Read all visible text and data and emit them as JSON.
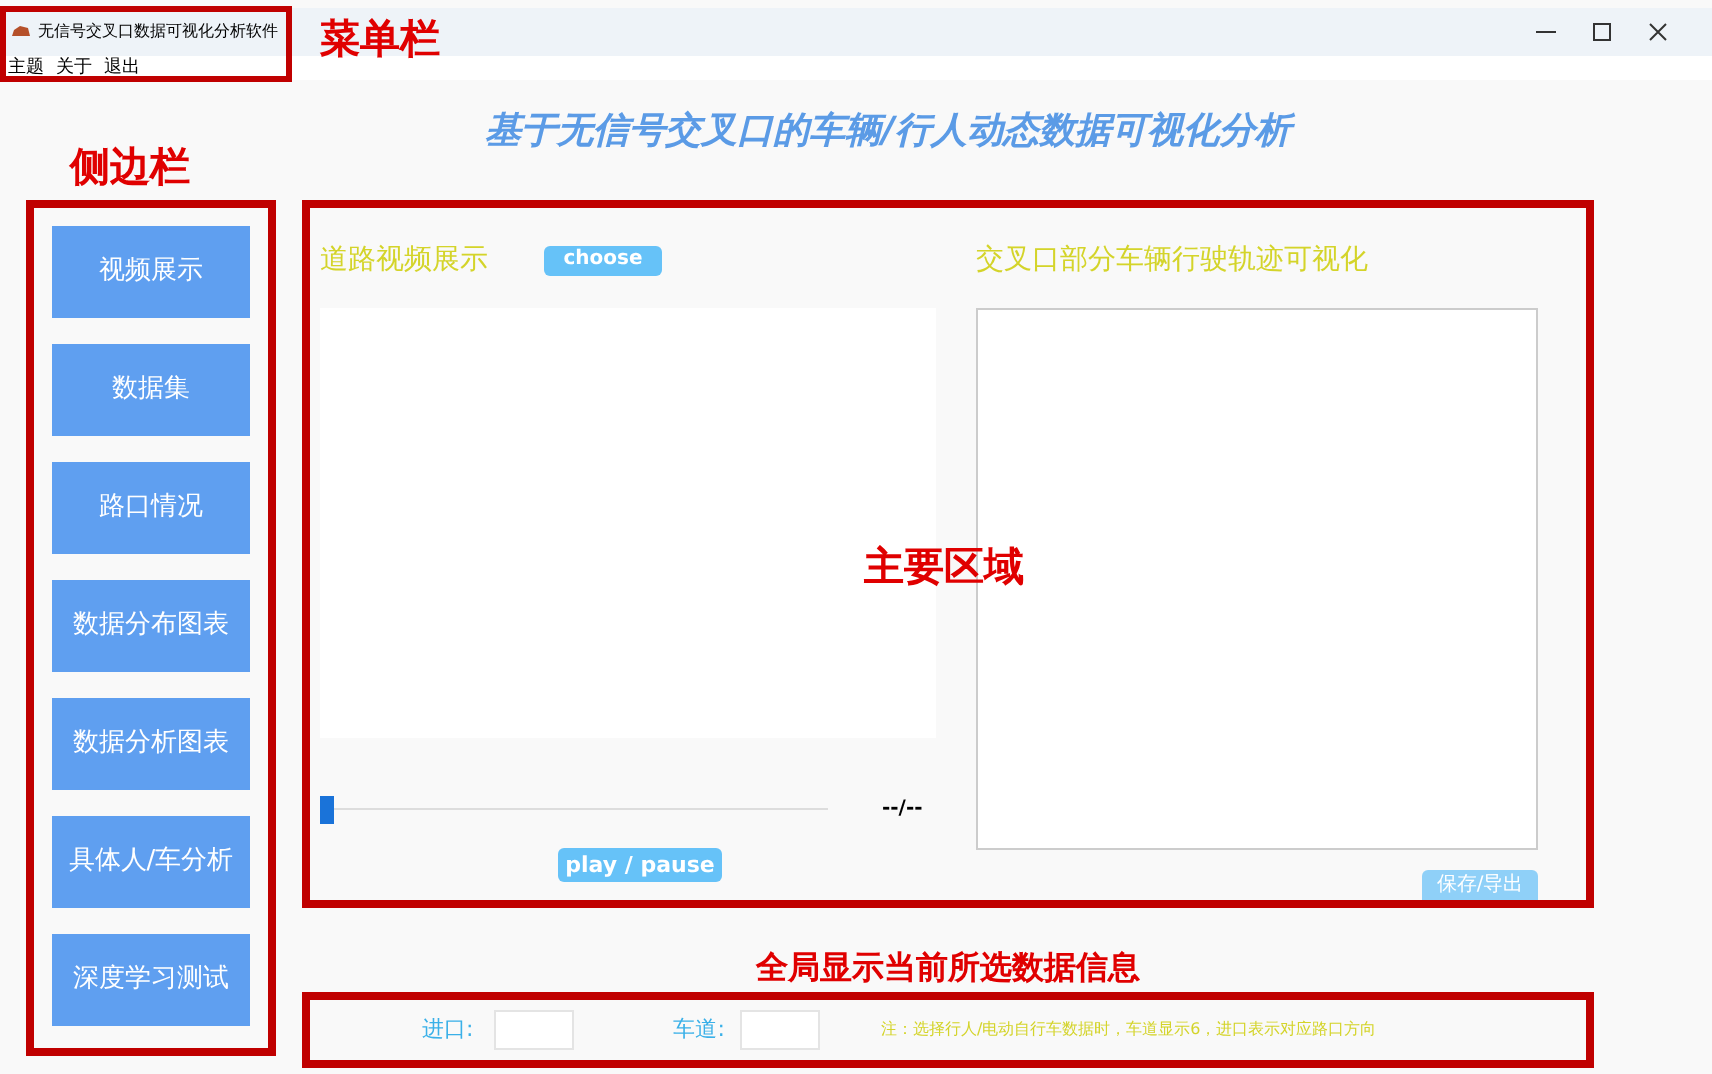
{
  "window": {
    "title": "无信号交叉口数据可视化分析软件"
  },
  "menu": [
    "主题",
    "关于",
    "退出"
  ],
  "heading": "基于无信号交叉口的车辆/行人动态数据可视化分析",
  "sidebar": {
    "items": [
      "视频展示",
      "数据集",
      "路口情况",
      "数据分布图表",
      "数据分析图表",
      "具体人/车分析",
      "深度学习测试"
    ]
  },
  "video": {
    "title": "道路视频展示",
    "choose": "choose",
    "progress": {
      "level": 0
    },
    "time": "--/--",
    "play": "play / pause"
  },
  "trajectory": {
    "title": "交叉口部分车辆行驶轨迹可视化",
    "save": "保存/导出"
  },
  "info": {
    "entry_label": "进口:",
    "lane_label": "车道:",
    "note": "注：选择行人/电动自行车数据时，车道显示6，进口表示对应路口方向"
  },
  "annotations": {
    "menu": "菜单栏",
    "sidebar": "侧边栏",
    "main": "主要区域",
    "info": "全局显示当前所选数据信息"
  }
}
